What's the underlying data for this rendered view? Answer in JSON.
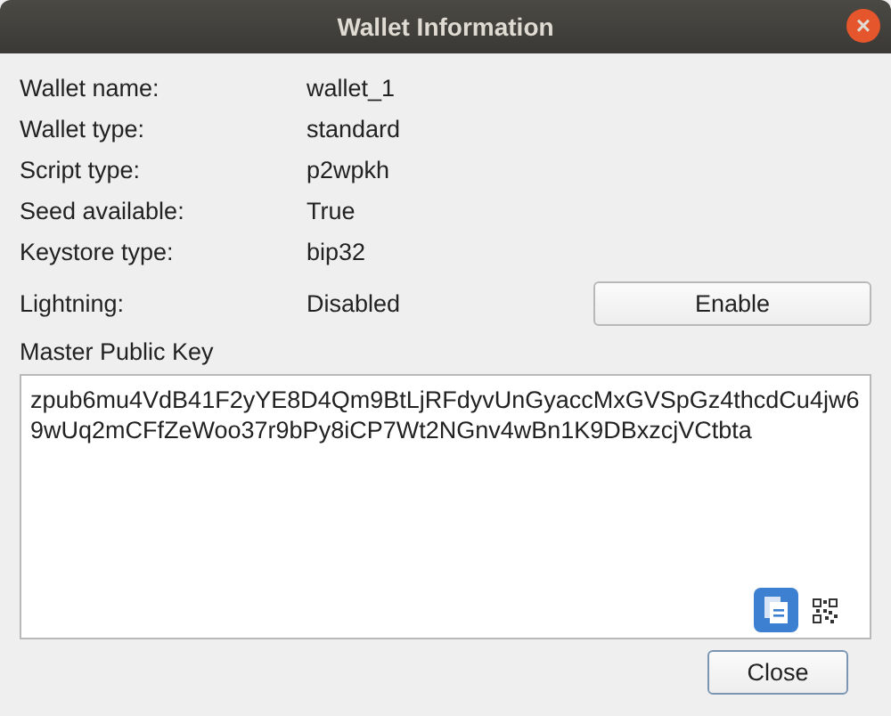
{
  "window": {
    "title": "Wallet Information",
    "close_symbol": "×"
  },
  "fields": [
    {
      "label": "Wallet name:",
      "value": "wallet_1"
    },
    {
      "label": "Wallet type:",
      "value": "standard"
    },
    {
      "label": "Script type:",
      "value": "p2wpkh"
    },
    {
      "label": "Seed available:",
      "value": "True"
    },
    {
      "label": "Keystore type:",
      "value": "bip32"
    }
  ],
  "lightning": {
    "label": "Lightning:",
    "value": "Disabled",
    "button": "Enable"
  },
  "master_public_key": {
    "label": "Master Public Key",
    "value": "zpub6mu4VdB41F2yYE8D4Qm9BtLjRFdyvUnGyaccMxGVSpGz4thcdCu4jw69wUq2mCFfZeWoo37r9bPy8iCP7Wt2NGnv4wBn1K9DBxzcjVCtbta"
  },
  "buttons": [
    "Close"
  ]
}
